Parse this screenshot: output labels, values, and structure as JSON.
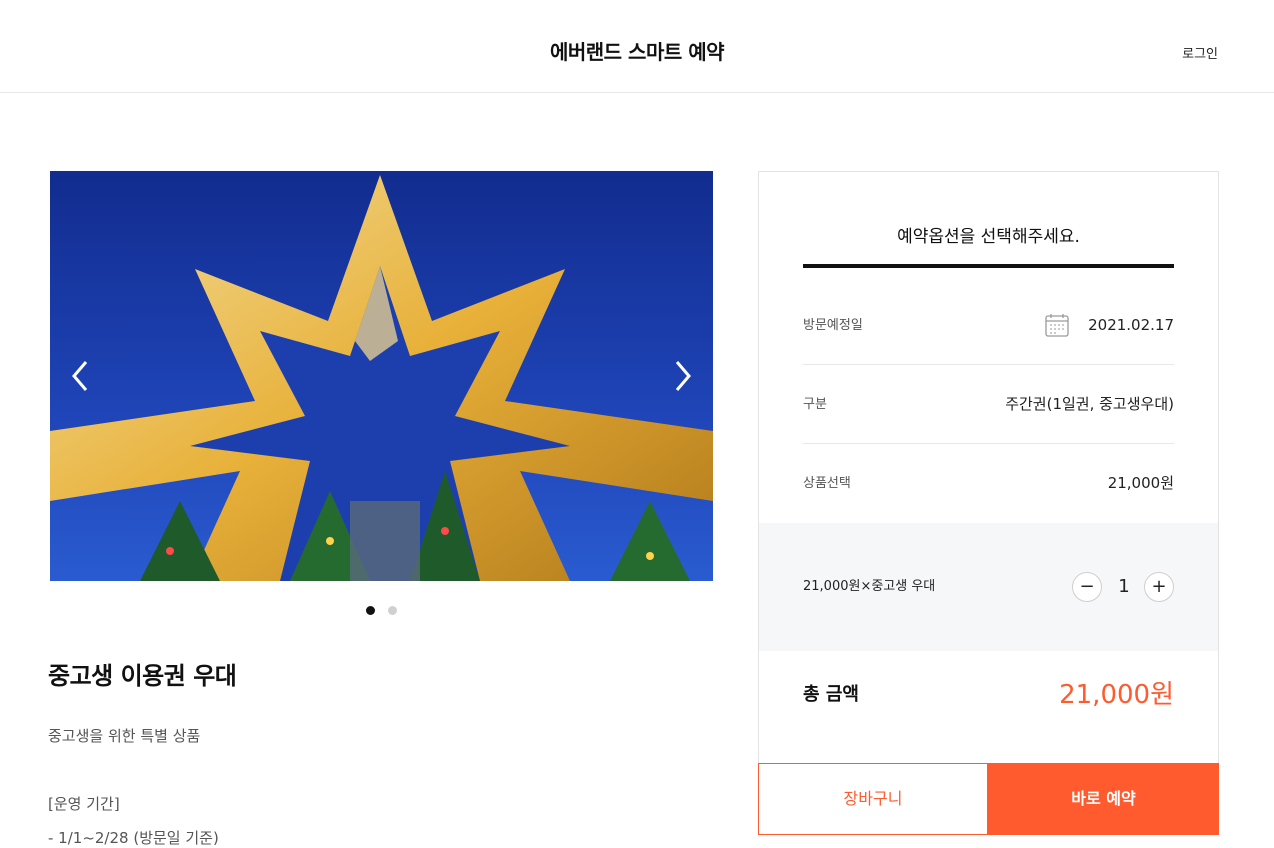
{
  "header": {
    "title": "에버랜드 스마트 예약",
    "login_label": "로그인"
  },
  "product": {
    "image_alt": "별 모양 조명 장식",
    "carousel_dots": [
      {
        "active": true
      },
      {
        "active": false
      }
    ],
    "title": "중고생 이용권 우대",
    "description": "중고생을 위한 특별 상품",
    "period_label": "[운영 기간]",
    "period_value": "- 1/1~2/28 (방문일 기준)"
  },
  "booking": {
    "heading": "예약옵션을 선택해주세요.",
    "visit_date_label": "방문예정일",
    "visit_date_value": "2021.02.17",
    "type_label": "구분",
    "type_value": "주간권(1일권, 중고생우대)",
    "product_label": "상품선택",
    "product_value": "21,000원",
    "quantity_item_label": "21,000원×중고생 우대",
    "quantity": "1",
    "minus_symbol": "−",
    "plus_symbol": "+",
    "total_label": "총 금액",
    "total_value": "21,000원"
  },
  "actions": {
    "cart_label": "장바구니",
    "book_label": "바로 예약"
  },
  "colors": {
    "accent": "#ff5b2e",
    "sky": "#1c3aa6",
    "lights": "#f2b632"
  },
  "icons": {
    "prev": "chevron-left-icon",
    "next": "chevron-right-icon",
    "calendar": "calendar-icon"
  }
}
